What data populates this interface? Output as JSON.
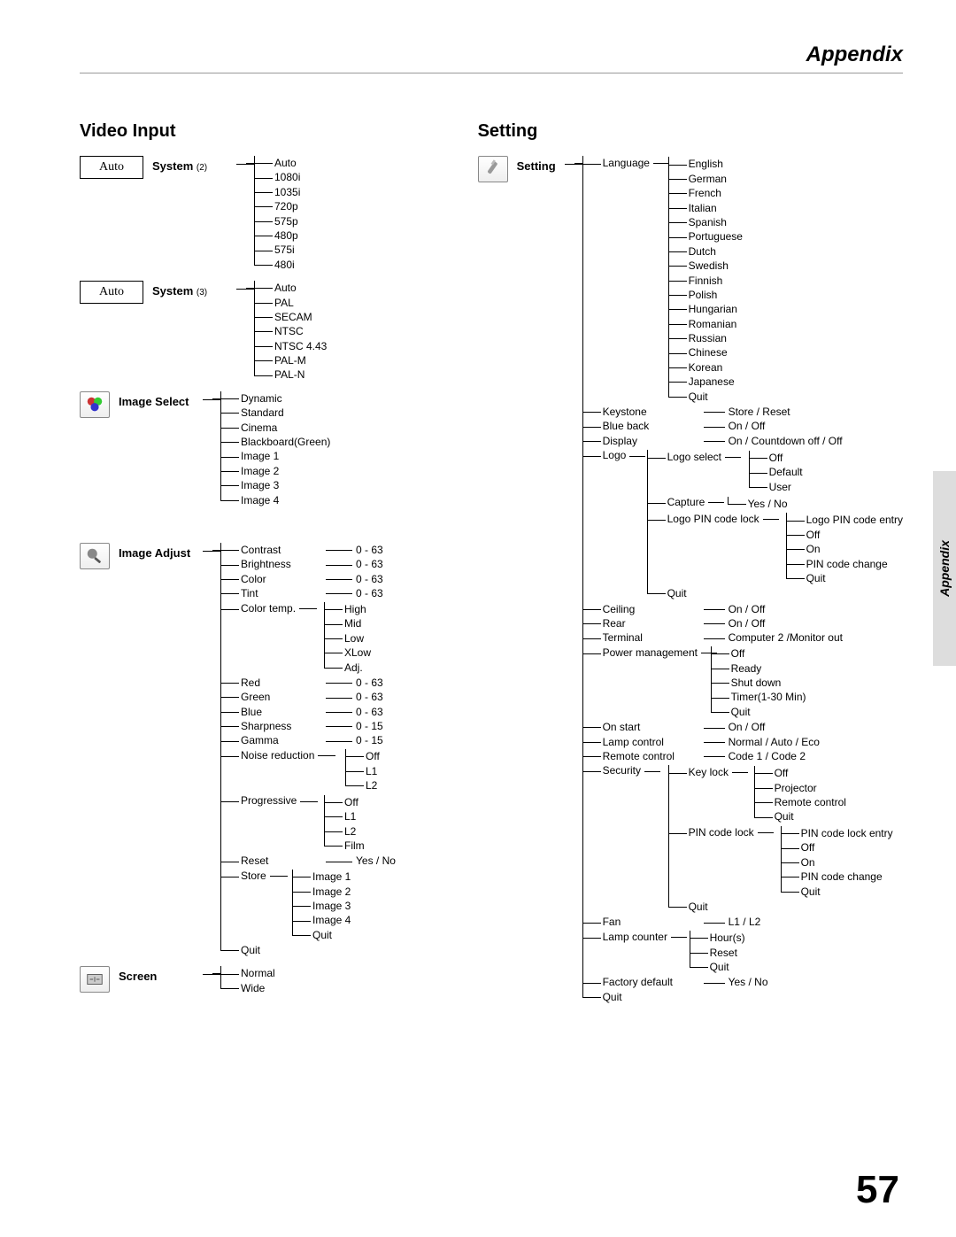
{
  "header": "Appendix",
  "side_tab": "Appendix",
  "page_number": "57",
  "video_input": {
    "title": "Video Input",
    "system2": {
      "box": "Auto",
      "label": "System",
      "note": "(2)",
      "items": [
        "Auto",
        "1080i",
        "1035i",
        "720p",
        "575p",
        "480p",
        "575i",
        "480i"
      ]
    },
    "system3": {
      "box": "Auto",
      "label": "System",
      "note": "(3)",
      "items": [
        "Auto",
        "PAL",
        "SECAM",
        "NTSC",
        "NTSC 4.43",
        "PAL-M",
        "PAL-N"
      ]
    },
    "image_select": {
      "label": "Image Select",
      "items": [
        "Dynamic",
        "Standard",
        "Cinema",
        "Blackboard(Green)",
        "Image 1",
        "Image 2",
        "Image 3",
        "Image 4"
      ]
    },
    "image_adjust": {
      "label": "Image Adjust",
      "items": [
        {
          "name": "Contrast",
          "range": "0 - 63"
        },
        {
          "name": "Brightness",
          "range": "0 - 63"
        },
        {
          "name": "Color",
          "range": "0 - 63"
        },
        {
          "name": "Tint",
          "range": "0 - 63"
        },
        {
          "name": "Color temp.",
          "sub": [
            "High",
            "Mid",
            "Low",
            "XLow",
            "Adj."
          ]
        },
        {
          "name": "Red",
          "range": "0 - 63"
        },
        {
          "name": "Green",
          "range": "0 - 63"
        },
        {
          "name": "Blue",
          "range": "0 - 63"
        },
        {
          "name": "Sharpness",
          "range": "0 - 15"
        },
        {
          "name": "Gamma",
          "range": "0 - 15"
        },
        {
          "name": "Noise reduction",
          "sub": [
            "Off",
            "L1",
            "L2"
          ]
        },
        {
          "name": "Progressive",
          "sub": [
            "Off",
            "L1",
            "L2",
            "Film"
          ]
        },
        {
          "name": "Reset",
          "range": "Yes / No"
        },
        {
          "name": "Store",
          "sub": [
            "Image 1",
            "Image 2",
            "Image 3",
            "Image 4",
            "Quit"
          ]
        },
        {
          "name": "Quit"
        }
      ]
    },
    "screen": {
      "label": "Screen",
      "items": [
        "Normal",
        "Wide"
      ]
    }
  },
  "setting": {
    "title": "Setting",
    "label": "Setting",
    "items": [
      {
        "name": "Language",
        "sub": [
          "English",
          "German",
          "French",
          "Italian",
          "Spanish",
          "Portuguese",
          "Dutch",
          "Swedish",
          "Finnish",
          "Polish",
          "Hungarian",
          "Romanian",
          "Russian",
          "Chinese",
          "Korean",
          "Japanese",
          "Quit"
        ]
      },
      {
        "name": "Keystone",
        "value": "Store / Reset"
      },
      {
        "name": "Blue back",
        "value": "On / Off"
      },
      {
        "name": "Display",
        "value": "On / Countdown off / Off"
      },
      {
        "name": "Logo",
        "sub": [
          {
            "name": "Logo select",
            "sub": [
              "Off",
              "Default",
              "User"
            ]
          },
          {
            "name": "Capture",
            "sub": [
              "Yes / No"
            ]
          },
          {
            "name": "Logo PIN code lock",
            "sub": [
              "Logo PIN code entry",
              "Off",
              "On",
              "PIN code change",
              "Quit"
            ]
          },
          {
            "name": "Quit"
          }
        ]
      },
      {
        "name": "Ceiling",
        "value": "On / Off"
      },
      {
        "name": "Rear",
        "value": "On / Off"
      },
      {
        "name": "Terminal",
        "value": "Computer 2 /Monitor out"
      },
      {
        "name": "Power management",
        "sub": [
          "Off",
          "Ready",
          "Shut down",
          "Timer(1-30 Min)",
          "Quit"
        ]
      },
      {
        "name": "On start",
        "value": "On / Off"
      },
      {
        "name": "Lamp control",
        "value": "Normal / Auto / Eco"
      },
      {
        "name": "Remote control",
        "value": "Code 1 / Code 2"
      },
      {
        "name": "Security",
        "sub": [
          {
            "name": "Key lock",
            "sub": [
              "Off",
              "Projector",
              "Remote control",
              "Quit"
            ]
          },
          {
            "name": "PIN code lock",
            "sub": [
              "PIN code lock entry",
              "Off",
              "On",
              "PIN code change",
              "Quit"
            ]
          },
          {
            "name": "Quit"
          }
        ]
      },
      {
        "name": "Fan",
        "value": "L1 / L2"
      },
      {
        "name": "Lamp counter",
        "sub": [
          "Hour(s)",
          "Reset",
          "Quit"
        ]
      },
      {
        "name": "Factory default",
        "value": "Yes / No"
      },
      {
        "name": "Quit"
      }
    ]
  }
}
